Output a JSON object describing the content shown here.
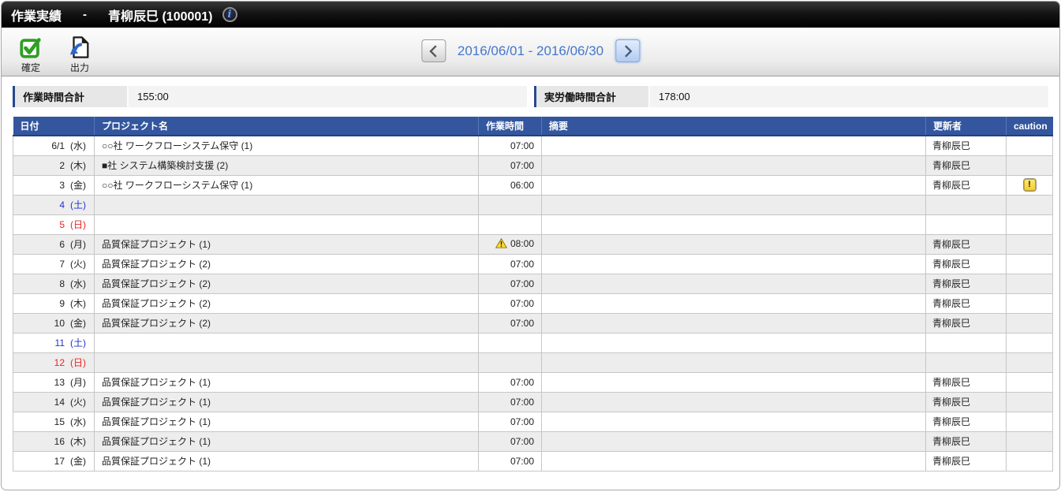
{
  "header": {
    "title": "作業実績",
    "separator": "-",
    "user": "青柳辰巳 (100001)"
  },
  "toolbar": {
    "confirm_label": "確定",
    "output_label": "出力"
  },
  "date_nav": {
    "range": "2016/06/01 - 2016/06/30"
  },
  "summary": {
    "items": [
      {
        "label": "作業時間合計",
        "value": "155:00"
      },
      {
        "label": "実労働時間合計",
        "value": "178:00"
      }
    ]
  },
  "table": {
    "columns": [
      "日付",
      "プロジェクト名",
      "作業時間",
      "摘要",
      "更新者",
      "caution"
    ],
    "rows": [
      {
        "date": "6/1",
        "day": "(水)",
        "day_type": "weekday",
        "project": "○○社 ワークフローシステム保守 (1)",
        "time": "07:00",
        "time_warning": false,
        "note": "",
        "updater": "青柳辰巳",
        "caution": false
      },
      {
        "date": "2",
        "day": "(木)",
        "day_type": "weekday",
        "project": "■社 システム構築検討支援 (2)",
        "time": "07:00",
        "time_warning": false,
        "note": "",
        "updater": "青柳辰巳",
        "caution": false
      },
      {
        "date": "3",
        "day": "(金)",
        "day_type": "weekday",
        "project": "○○社 ワークフローシステム保守 (1)",
        "time": "06:00",
        "time_warning": false,
        "note": "",
        "updater": "青柳辰巳",
        "caution": true
      },
      {
        "date": "4",
        "day": "(土)",
        "day_type": "saturday",
        "project": "",
        "time": "",
        "time_warning": false,
        "note": "",
        "updater": "",
        "caution": false
      },
      {
        "date": "5",
        "day": "(日)",
        "day_type": "sunday",
        "project": "",
        "time": "",
        "time_warning": false,
        "note": "",
        "updater": "",
        "caution": false
      },
      {
        "date": "6",
        "day": "(月)",
        "day_type": "weekday",
        "project": "品質保証プロジェクト (1)",
        "time": "08:00",
        "time_warning": true,
        "note": "",
        "updater": "青柳辰巳",
        "caution": false
      },
      {
        "date": "7",
        "day": "(火)",
        "day_type": "weekday",
        "project": "品質保証プロジェクト (2)",
        "time": "07:00",
        "time_warning": false,
        "note": "",
        "updater": "青柳辰巳",
        "caution": false
      },
      {
        "date": "8",
        "day": "(水)",
        "day_type": "weekday",
        "project": "品質保証プロジェクト (2)",
        "time": "07:00",
        "time_warning": false,
        "note": "",
        "updater": "青柳辰巳",
        "caution": false
      },
      {
        "date": "9",
        "day": "(木)",
        "day_type": "weekday",
        "project": "品質保証プロジェクト (2)",
        "time": "07:00",
        "time_warning": false,
        "note": "",
        "updater": "青柳辰巳",
        "caution": false
      },
      {
        "date": "10",
        "day": "(金)",
        "day_type": "weekday",
        "project": "品質保証プロジェクト (2)",
        "time": "07:00",
        "time_warning": false,
        "note": "",
        "updater": "青柳辰巳",
        "caution": false
      },
      {
        "date": "11",
        "day": "(土)",
        "day_type": "saturday",
        "project": "",
        "time": "",
        "time_warning": false,
        "note": "",
        "updater": "",
        "caution": false
      },
      {
        "date": "12",
        "day": "(日)",
        "day_type": "sunday",
        "project": "",
        "time": "",
        "time_warning": false,
        "note": "",
        "updater": "",
        "caution": false
      },
      {
        "date": "13",
        "day": "(月)",
        "day_type": "weekday",
        "project": "品質保証プロジェクト (1)",
        "time": "07:00",
        "time_warning": false,
        "note": "",
        "updater": "青柳辰巳",
        "caution": false
      },
      {
        "date": "14",
        "day": "(火)",
        "day_type": "weekday",
        "project": "品質保証プロジェクト (1)",
        "time": "07:00",
        "time_warning": false,
        "note": "",
        "updater": "青柳辰巳",
        "caution": false
      },
      {
        "date": "15",
        "day": "(水)",
        "day_type": "weekday",
        "project": "品質保証プロジェクト (1)",
        "time": "07:00",
        "time_warning": false,
        "note": "",
        "updater": "青柳辰巳",
        "caution": false
      },
      {
        "date": "16",
        "day": "(木)",
        "day_type": "weekday",
        "project": "品質保証プロジェクト (1)",
        "time": "07:00",
        "time_warning": false,
        "note": "",
        "updater": "青柳辰巳",
        "caution": false
      },
      {
        "date": "17",
        "day": "(金)",
        "day_type": "weekday",
        "project": "品質保証プロジェクト (1)",
        "time": "07:00",
        "time_warning": false,
        "note": "",
        "updater": "青柳辰巳",
        "caution": false
      }
    ]
  },
  "icons": {
    "info_glyph": "i",
    "caution_glyph": "!"
  },
  "colors": {
    "header_blue": "#33569e",
    "accent_navy": "#26488e",
    "saturday_blue": "#2233cc",
    "sunday_red": "#ee2222",
    "link_blue": "#4477cc",
    "confirm_green": "#2f9e23",
    "output_arrow_blue": "#2a66cc",
    "caution_yellow": "#f2cc30",
    "warning_yellow": "#ffd92e"
  }
}
